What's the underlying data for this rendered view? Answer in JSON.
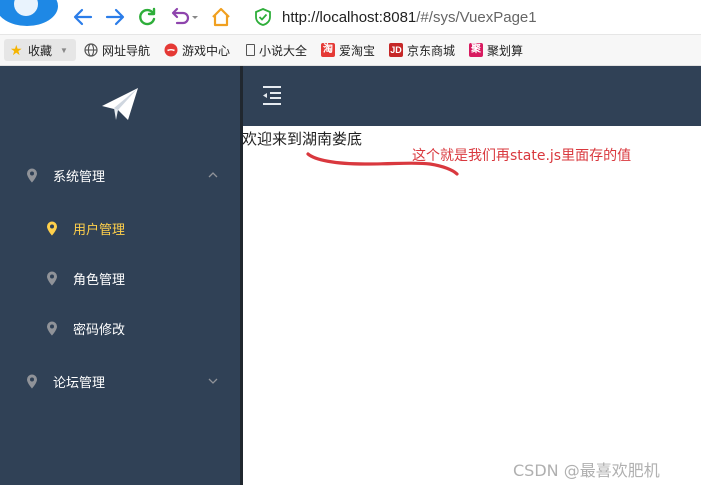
{
  "browser": {
    "url_host": "http://localhost:8081",
    "url_path": "/#/sys/VuexPage1"
  },
  "bookmarks": [
    {
      "label": "收藏",
      "icon": "star-icon"
    },
    {
      "label": "网址导航",
      "icon": "globe-icon"
    },
    {
      "label": "游戏中心",
      "icon": "game-icon"
    },
    {
      "label": "小说大全",
      "icon": "book-icon"
    },
    {
      "label": "爱淘宝",
      "icon": "taobao-icon",
      "badge": "淘"
    },
    {
      "label": "京东商城",
      "icon": "jd-icon",
      "badge": "JD"
    },
    {
      "label": "聚划算",
      "icon": "juhuasuan-icon",
      "badge": "聚"
    }
  ],
  "sidebar": {
    "items": [
      {
        "label": "系统管理",
        "level": 1,
        "expanded": true
      },
      {
        "label": "用户管理",
        "level": 2,
        "active": true
      },
      {
        "label": "角色管理",
        "level": 2
      },
      {
        "label": "密码修改",
        "level": 2
      },
      {
        "label": "论坛管理",
        "level": 1,
        "expanded": false
      }
    ],
    "active_color": "#ffd04b",
    "bg_color": "#304156"
  },
  "content": {
    "welcome_text": "欢迎来到湖南娄底",
    "annotation": "这个就是我们再state.js里面存的值"
  },
  "watermark": "CSDN @最喜欢肥机"
}
